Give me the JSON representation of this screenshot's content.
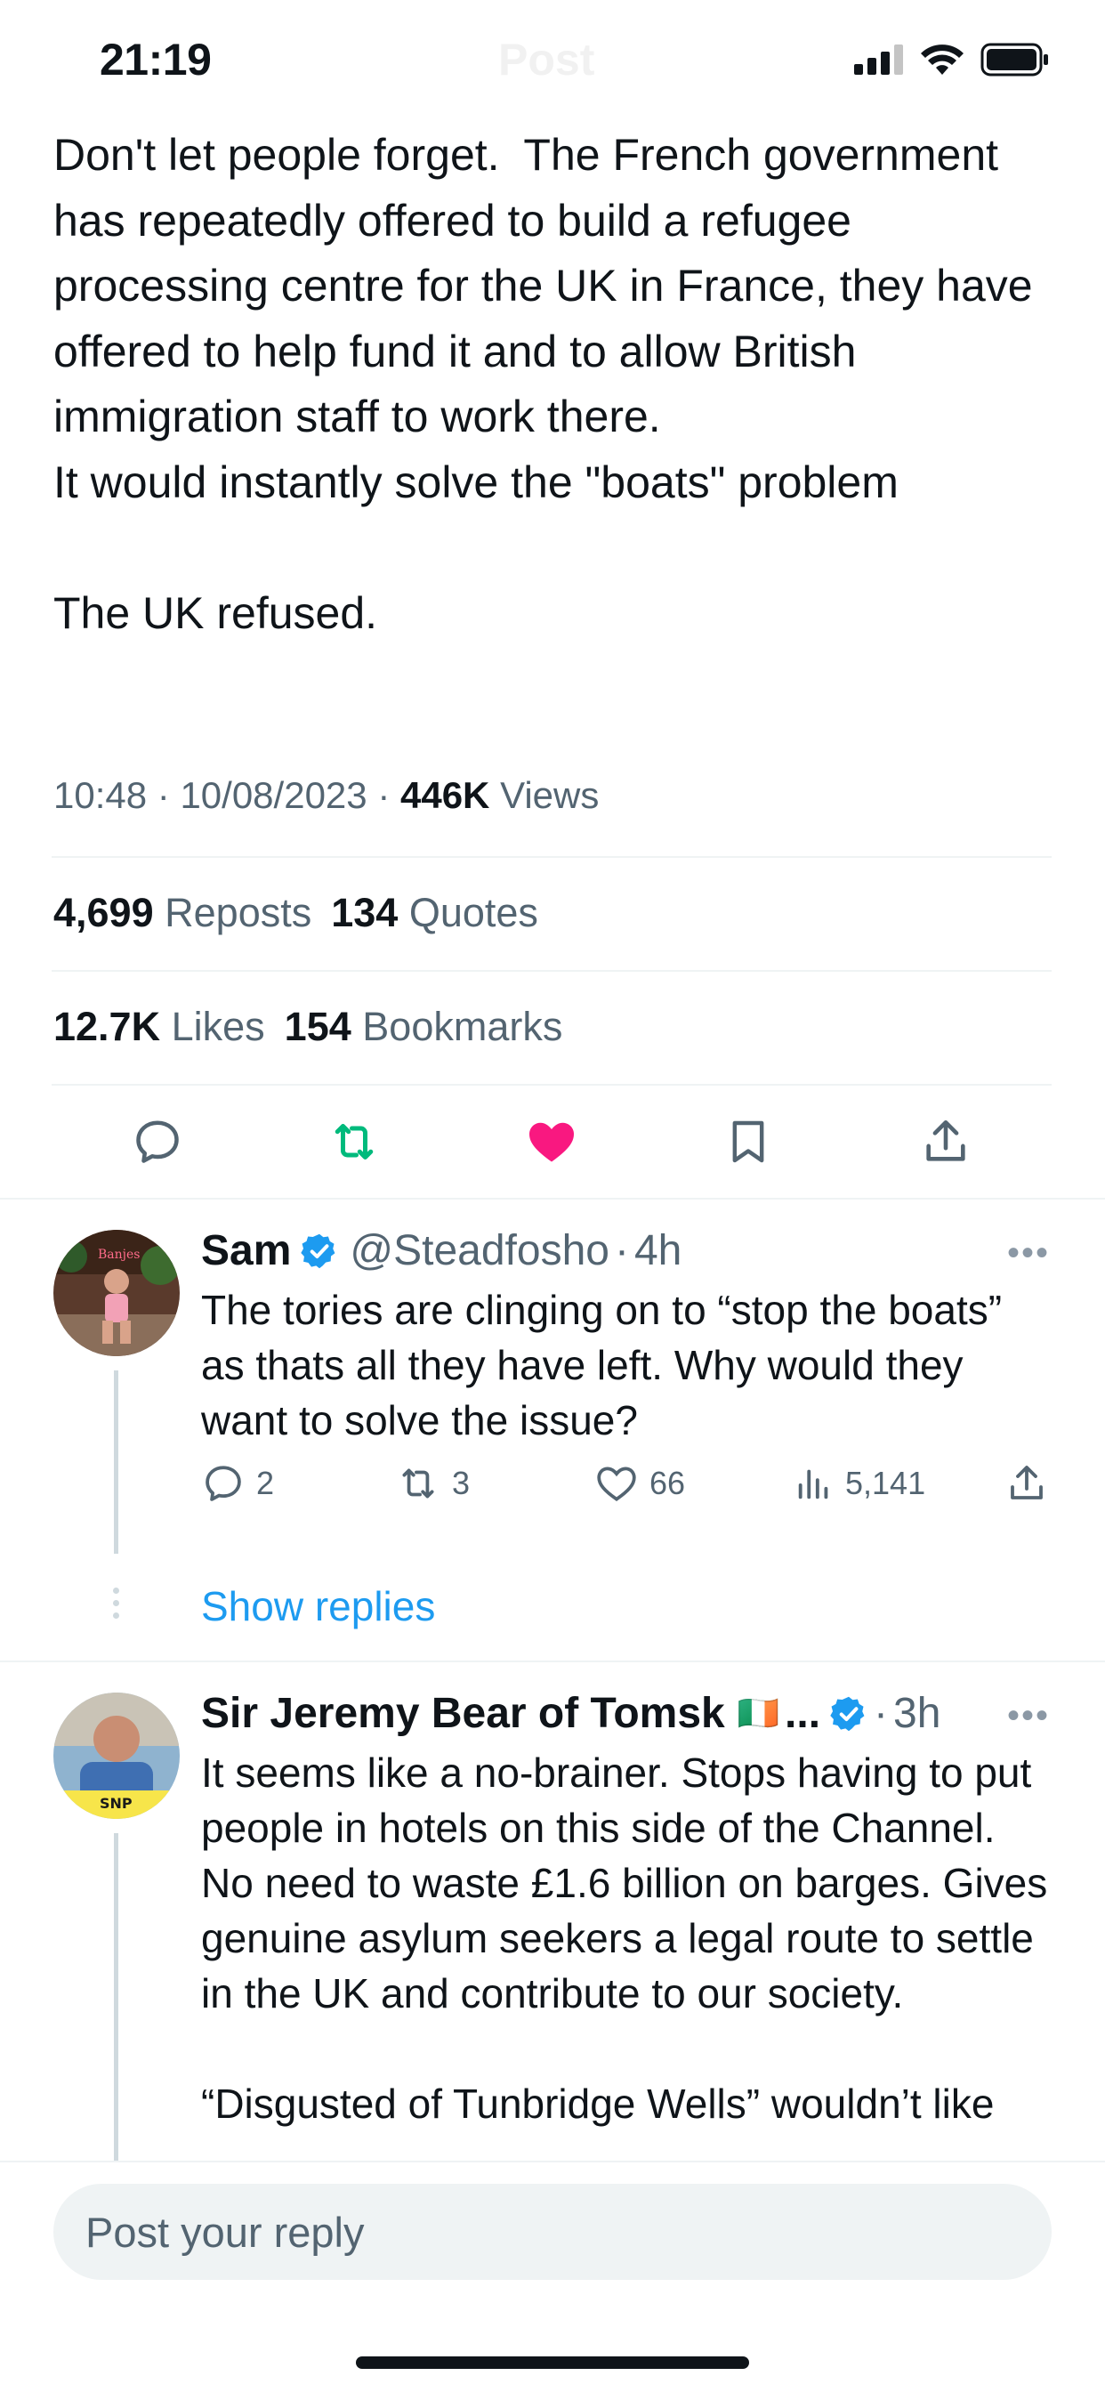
{
  "status_bar": {
    "time": "21:19",
    "header_title": "Post"
  },
  "tweet": {
    "text": "Don't let people forget.  The French government has repeatedly offered to build a refugee processing centre for the UK in France, they have offered to help fund it and to allow British immigration staff to work there.\nIt would instantly solve the \"boats\" problem\n\nThe UK refused.",
    "time": "10:48",
    "date": "10/08/2023",
    "views_count": "446K",
    "views_label": "Views",
    "reposts_count": "4,699",
    "reposts_label": "Reposts",
    "quotes_count": "134",
    "quotes_label": "Quotes",
    "likes_count": "12.7K",
    "likes_label": "Likes",
    "bookmarks_count": "154",
    "bookmarks_label": "Bookmarks",
    "liked": true
  },
  "replies": [
    {
      "name": "Sam",
      "handle": "@Steadfosho",
      "age": "4h",
      "verified": true,
      "avatar_label": "Banjes",
      "text": "The tories are clinging on to “stop the boats” as thats all they have left. Why would they want to solve the issue?",
      "reply_count": "2",
      "repost_count": "3",
      "like_count": "66",
      "view_count": "5,141",
      "show_replies_label": "Show replies"
    },
    {
      "name": "Sir Jeremy Bear of Tomsk",
      "flag": "🇮🇪",
      "ellipsis": "...",
      "handle": "",
      "age": "3h",
      "verified": true,
      "avatar_label": "SNP",
      "text": "It seems like a no-brainer. Stops having to put people in hotels on this side of the Channel. No need to waste £1.6 billion on barges. Gives genuine asylum seekers a legal route to settle in the UK and contribute to our society.\n\n“Disgusted of Tunbridge Wells” wouldn’t like"
    }
  ],
  "composer": {
    "placeholder": "Post your reply"
  },
  "colors": {
    "accent": "#1d9bf0",
    "like": "#f91880",
    "repost": "#00ba7c",
    "secondary_text": "#536471",
    "divider": "#eff3f4"
  },
  "icons": [
    "back-arrow-icon",
    "signal-icon",
    "wifi-icon",
    "battery-icon",
    "reply-icon",
    "repost-icon",
    "heart-icon",
    "bookmark-icon",
    "share-icon",
    "verified-icon",
    "more-icon",
    "views-icon"
  ]
}
